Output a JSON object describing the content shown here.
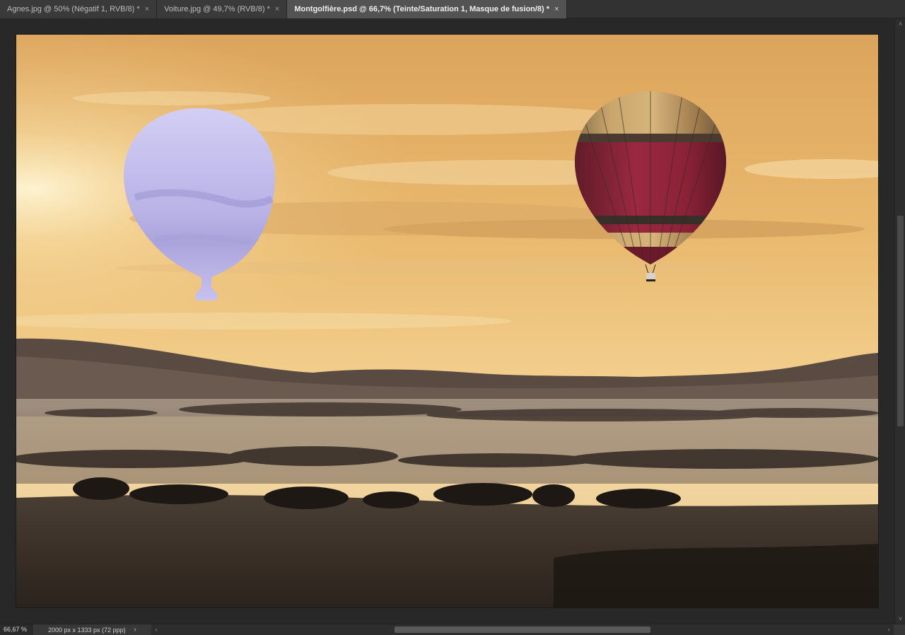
{
  "tabs": [
    {
      "label": "Agnes.jpg @ 50% (Négatif 1, RVB/8) *",
      "close": "×",
      "active": false
    },
    {
      "label": "Voiture.jpg @ 49,7% (RVB/8) *",
      "close": "×",
      "active": false
    },
    {
      "label": "Montgolfière.psd @ 66,7% (Teinte/Saturation 1, Masque de fusion/8) *",
      "close": "×",
      "active": true
    }
  ],
  "status": {
    "zoom": "66,67 %",
    "doc_info": "2000 px x 1333 px (72 ppp)",
    "menu_arrow": "›",
    "scroll_left": "‹",
    "scroll_right": "›",
    "scroll_up": "˄",
    "scroll_down": "˅"
  },
  "canvas": {
    "icons": {
      "mask_balloon": "balloon-mask-silhouette",
      "balloon": "hot-air-balloon"
    },
    "colors": {
      "sky_top": "#e0a860",
      "sky_mid": "#f0c880",
      "horizon": "#f8dca0",
      "mask_fill": "#c4c0ee",
      "balloon_red": "#8a2235",
      "balloon_gold": "#c8a468",
      "hills": "#4a3e38",
      "foreground": "#2e2620"
    }
  }
}
